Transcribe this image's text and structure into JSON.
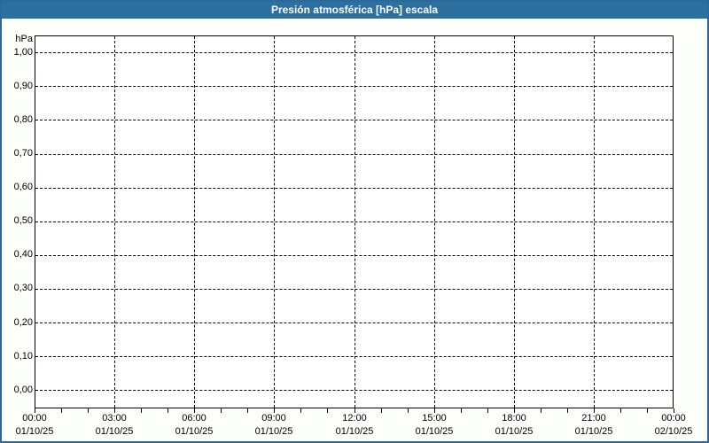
{
  "window": {
    "title": "Presión atmosférica [hPa] escala",
    "colors": {
      "titlebar_bg": "#2d6f9f",
      "window_border": "#2a6999",
      "page_background": "#fdfffb",
      "plot_background": "#ffffff",
      "grid_color": "#000000",
      "label_color": "#000000",
      "title_text_color": "#ffffff"
    }
  },
  "chart_data": {
    "type": "line",
    "title": "Presión atmosférica [hPa] escala",
    "ylabel": "hPa",
    "ylim": [
      0.0,
      1.0
    ],
    "ytick_values": [
      1.0,
      0.9,
      0.8,
      0.7,
      0.6,
      0.5,
      0.4,
      0.3,
      0.2,
      0.1,
      0.0
    ],
    "ytick_labels": [
      "1,00",
      "0,90",
      "0,80",
      "0,70",
      "0,60",
      "0,50",
      "0,40",
      "0,30",
      "0,20",
      "0,10",
      "0,00"
    ],
    "x_range_hours": [
      0,
      24
    ],
    "xtick_interval_hours": 3,
    "minor_tick_interval_hours": 1,
    "xticks": [
      {
        "time": "00:00",
        "date": "01/10/25"
      },
      {
        "time": "03:00",
        "date": "01/10/25"
      },
      {
        "time": "06:00",
        "date": "01/10/25"
      },
      {
        "time": "09:00",
        "date": "01/10/25"
      },
      {
        "time": "12:00",
        "date": "01/10/25"
      },
      {
        "time": "15:00",
        "date": "01/10/25"
      },
      {
        "time": "18:00",
        "date": "01/10/25"
      },
      {
        "time": "21:00",
        "date": "01/10/25"
      },
      {
        "time": "00:00",
        "date": "02/10/25"
      }
    ],
    "grid": true,
    "legend": null,
    "series": []
  }
}
